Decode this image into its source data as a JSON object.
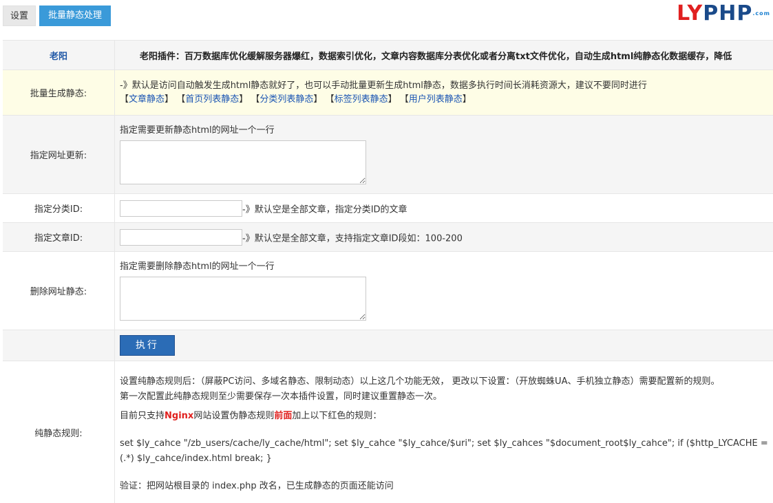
{
  "tabs": {
    "settings": "设置",
    "batch": "批量静态处理"
  },
  "logo": {
    "part1": "LY",
    "part2": "PHP",
    "suffix": ".com"
  },
  "header": {
    "author": "老阳",
    "description": "老阳插件：百万数据库优化缓解服务器爆红，数据索引优化，文章内容数据库分表优化或者分离txt文件优化，自动生成html纯静态化数据缓存，降低"
  },
  "batch": {
    "label": "批量生成静态:",
    "note": "-》默认是访问自动触发生成html静态就好了，也可以手动批量更新生成html静态，数据多执行时间长消耗资源大，建议不要同时进行",
    "links": [
      "文章静态",
      "首页列表静态",
      "分类列表静态",
      "标签列表静态",
      "用户列表静态"
    ]
  },
  "url_update": {
    "label": "指定网址更新:",
    "hint": "指定需要更新静态html的网址一个一行",
    "value": ""
  },
  "category": {
    "label": "指定分类ID:",
    "value": "",
    "note": "-》默认空是全部文章，指定分类ID的文章"
  },
  "article": {
    "label": "指定文章ID:",
    "value": "",
    "note": "-》默认空是全部文章，支持指定文章ID段如：100-200"
  },
  "url_delete": {
    "label": "删除网址静态:",
    "hint": "指定需要删除静态html的网址一个一行",
    "value": ""
  },
  "execute": {
    "label": "执行"
  },
  "rules": {
    "label": "纯静态规则:",
    "line1": "设置纯静态规则后：（屏蔽PC访问、多域名静态、限制动态）以上这几个功能无效， 更改以下设置：（开放蜘蛛UA、手机独立静态）需要配置新的规则。",
    "line2": "第一次配置此纯静态规则至少需要保存一次本插件设置，同时建议重置静态一次。",
    "line3_pre": "目前只支持",
    "line3_nginx": "Nginx",
    "line3_mid": "网站设置伪静态规则",
    "line3_front": "前面",
    "line3_post": "加上以下红色的规则：",
    "code1": "set $ly_cahce \"/zb_users/cache/ly_cache/html\"; set $ly_cahce \"$ly_cahce/$uri\"; set $ly_cahces \"$document_root$ly_cahce\"; if ($http_LYCACHE =",
    "code2": "(.*) $ly_cahce/index.html break; }",
    "verify": "验证：把网站根目录的 index.php 改名，已生成静态的页面还能访问"
  }
}
